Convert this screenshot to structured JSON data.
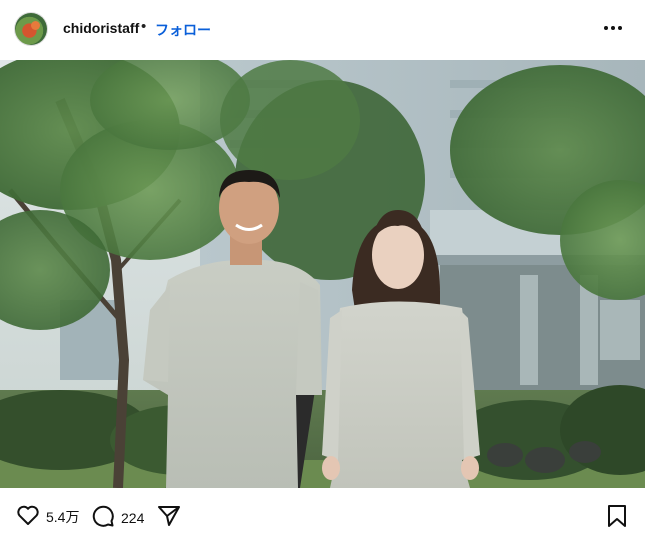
{
  "header": {
    "username": "chidoristaff",
    "separator": "•",
    "follow_label": "フォロー",
    "more_icon": "more-horizontal-icon"
  },
  "photo": {
    "description_icon": "post-image"
  },
  "actions": {
    "like_icon": "heart-icon",
    "like_count": "5.4万",
    "comment_icon": "comment-icon",
    "comment_count": "224",
    "share_icon": "send-icon",
    "save_icon": "bookmark-icon"
  }
}
